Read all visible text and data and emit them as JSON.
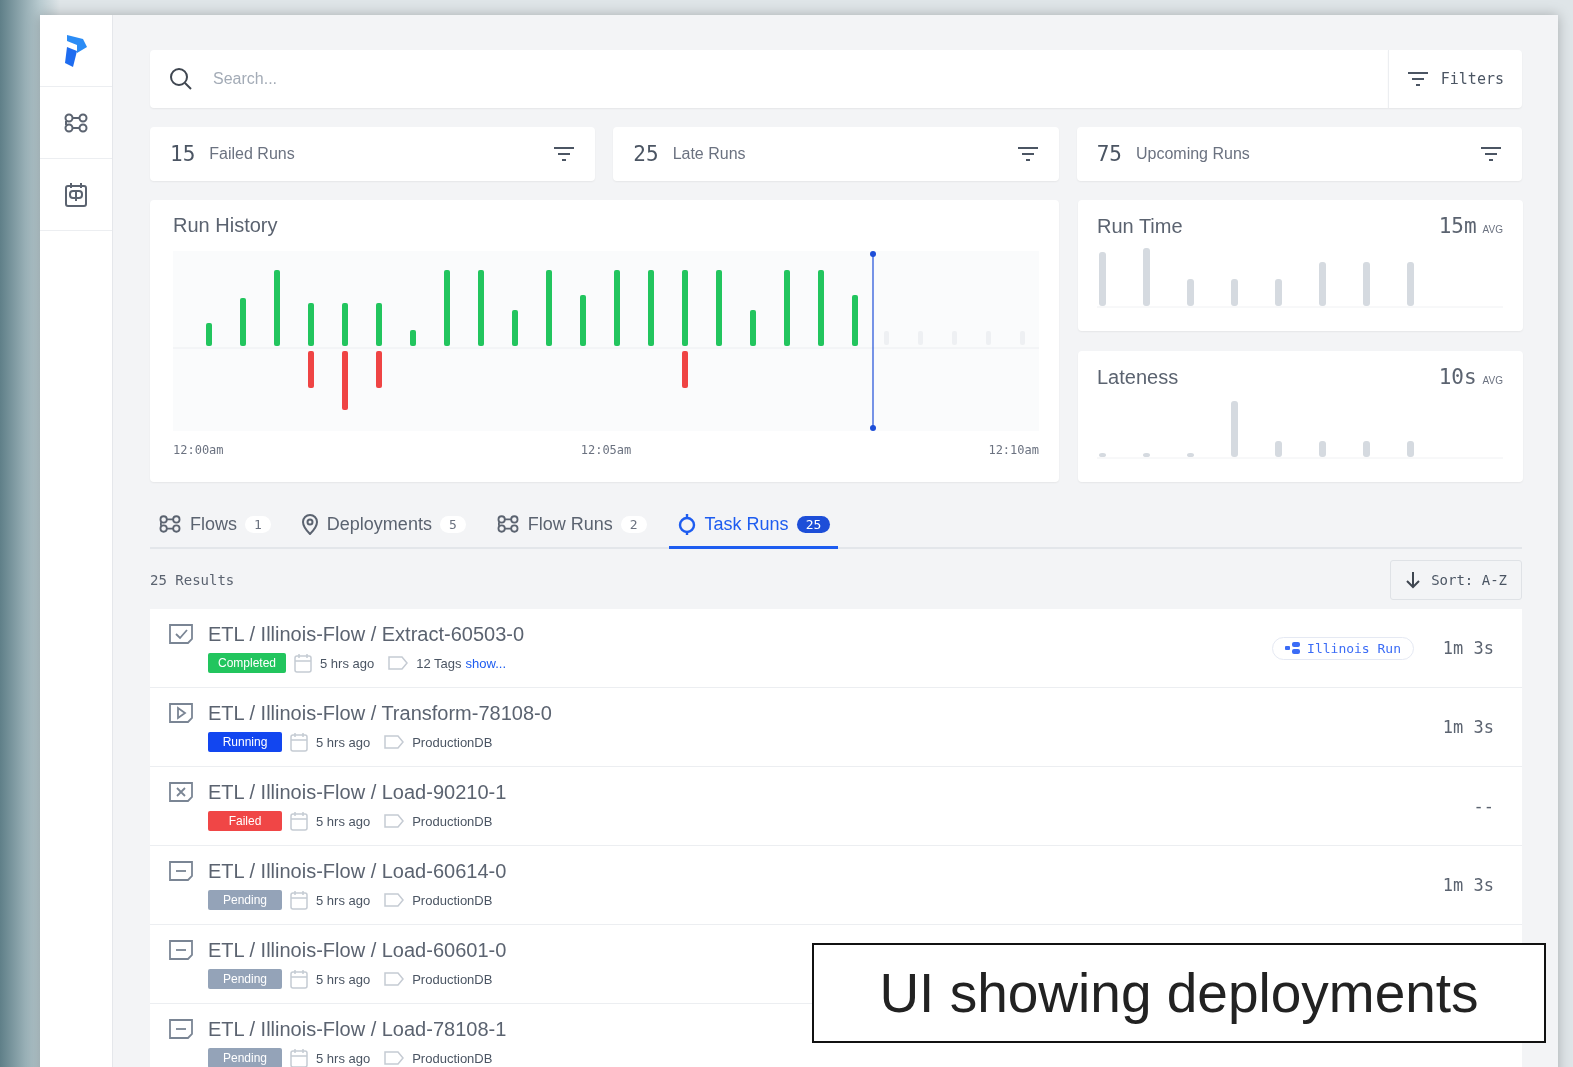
{
  "search": {
    "placeholder": "Search...",
    "filters_button": "Filters"
  },
  "stat_cards": [
    {
      "count": "15",
      "label": "Failed Runs"
    },
    {
      "count": "25",
      "label": "Late Runs"
    },
    {
      "count": "75",
      "label": "Upcoming Runs"
    }
  ],
  "run_history": {
    "title": "Run History",
    "x_labels": [
      "12:00am",
      "12:05am",
      "12:10am"
    ]
  },
  "metrics": [
    {
      "title": "Run Time",
      "value": "15m",
      "unit": "AVG"
    },
    {
      "title": "Lateness",
      "value": "10s",
      "unit": "AVG"
    }
  ],
  "tabs": [
    {
      "kind": "flows",
      "label": "Flows",
      "count": "1",
      "selected": false
    },
    {
      "kind": "deployments",
      "label": "Deployments",
      "count": "5",
      "selected": false
    },
    {
      "kind": "flow_runs",
      "label": "Flow Runs",
      "count": "2",
      "selected": false
    },
    {
      "kind": "task_runs",
      "label": "Task Runs",
      "count": "25",
      "selected": true
    }
  ],
  "results": "25 Results",
  "sort_button": "Sort: A-Z",
  "rows": [
    {
      "kind": "completed",
      "title": "ETL / Illinois-Flow / Extract-60503-0",
      "status": "Completed",
      "time": "5 hrs ago",
      "tags": "12 Tags",
      "tags_link": "show...",
      "run_badge": "Illinois Run",
      "duration": "1m 3s"
    },
    {
      "kind": "running",
      "title": "ETL / Illinois-Flow / Transform-78108-0",
      "status": "Running",
      "time": "5 hrs ago",
      "tags": "ProductionDB",
      "duration": "1m 3s"
    },
    {
      "kind": "failed",
      "title": "ETL / Illinois-Flow / Load-90210-1",
      "status": "Failed",
      "time": "5 hrs ago",
      "tags": "ProductionDB",
      "duration": "--"
    },
    {
      "kind": "pending",
      "title": "ETL / Illinois-Flow / Load-60614-0",
      "status": "Pending",
      "time": "5 hrs ago",
      "tags": "ProductionDB",
      "duration": "1m 3s"
    },
    {
      "kind": "pending",
      "title": "ETL / Illinois-Flow / Load-60601-0",
      "status": "Pending",
      "time": "5 hrs ago",
      "tags": "ProductionDB"
    },
    {
      "kind": "pending",
      "title": "ETL / Illinois-Flow / Load-78108-1",
      "status": "Pending",
      "time": "5 hrs ago",
      "tags": "ProductionDB"
    }
  ],
  "caption": "UI showing deployments"
}
